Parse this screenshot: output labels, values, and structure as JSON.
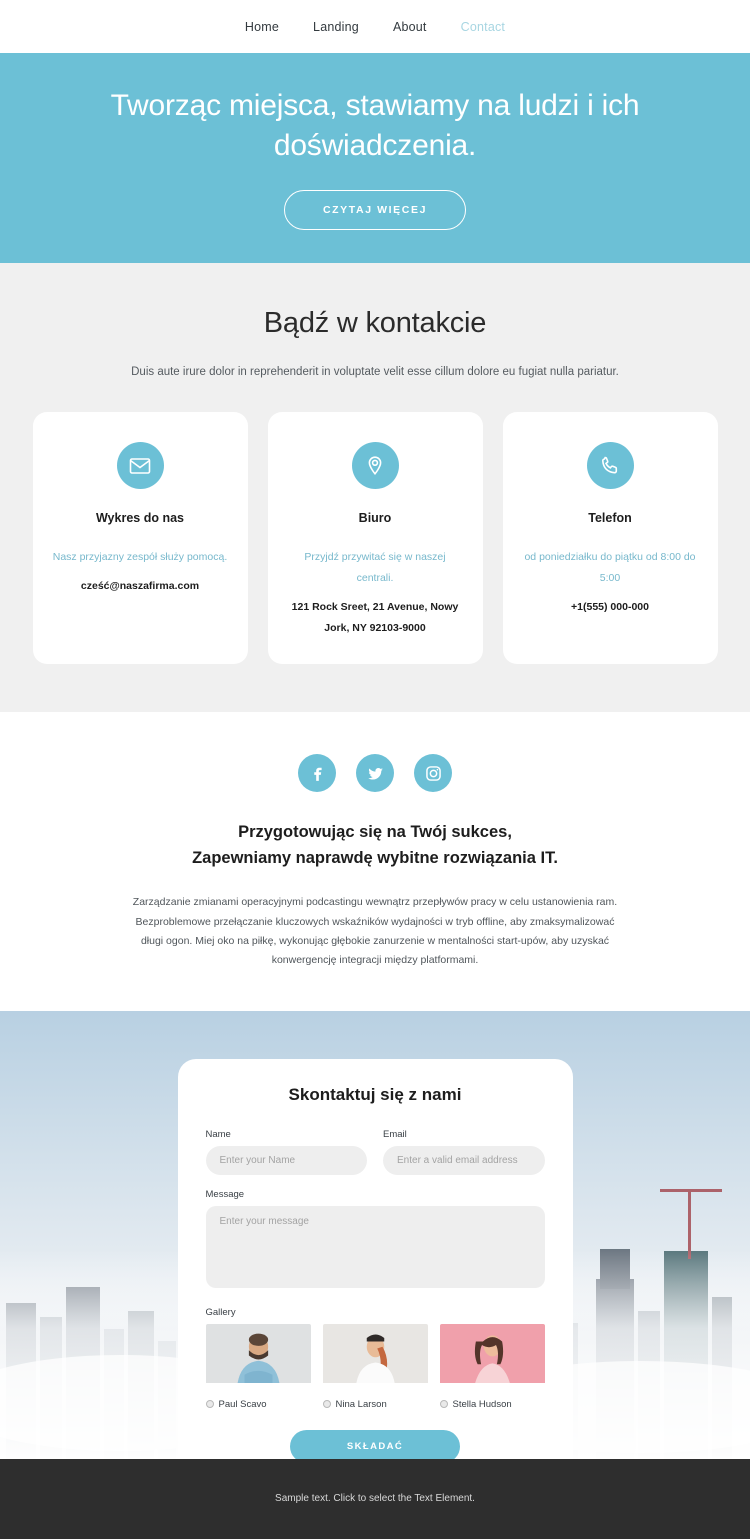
{
  "nav": {
    "items": [
      {
        "label": "Home",
        "active": false
      },
      {
        "label": "Landing",
        "active": false
      },
      {
        "label": "About",
        "active": false
      },
      {
        "label": "Contact",
        "active": true
      }
    ]
  },
  "hero": {
    "title": "Tworząc miejsca, stawiamy na ludzi i ich doświadczenia.",
    "cta_label": "CZYTAJ WIĘCEJ"
  },
  "contact": {
    "title": "Bądź w kontakcie",
    "subtitle": "Duis aute irure dolor in reprehenderit in voluptate velit esse cillum dolore eu fugiat nulla pariatur.",
    "cards": [
      {
        "icon": "envelope-icon",
        "title": "Wykres do nas",
        "note": "Nasz przyjazny zespół służy pomocą.",
        "value": "cześć@naszafirma.com"
      },
      {
        "icon": "map-pin-icon",
        "title": "Biuro",
        "note": "Przyjdź przywitać się w naszej centrali.",
        "value": "121 Rock Sreet, 21 Avenue, Nowy Jork, NY 92103-9000"
      },
      {
        "icon": "phone-icon",
        "title": "Telefon",
        "note": "od poniedziałku do piątku od 8:00 do 5:00",
        "value": "+1(555) 000-000"
      }
    ]
  },
  "about": {
    "socials": [
      {
        "name": "facebook-icon"
      },
      {
        "name": "twitter-icon"
      },
      {
        "name": "instagram-icon"
      }
    ],
    "title_line1": "Przygotowując się na Twój sukces,",
    "title_line2": "Zapewniamy naprawdę wybitne rozwiązania IT.",
    "body": "Zarządzanie zmianami operacyjnymi podcastingu wewnątrz przepływów pracy w celu ustanowienia ram. Bezproblemowe przełączanie kluczowych wskaźników wydajności w tryb offline, aby zmaksymalizować długi ogon. Miej oko na piłkę, wykonując głębokie zanurzenie w mentalności start-upów, aby uzyskać konwergencję integracji między platformami."
  },
  "form": {
    "title": "Skontaktuj się z nami",
    "name_label": "Name",
    "name_placeholder": "Enter your Name",
    "name_value": "",
    "email_label": "Email",
    "email_placeholder": "Enter a valid email address",
    "email_value": "",
    "message_label": "Message",
    "message_placeholder": "Enter your message",
    "message_value": "",
    "gallery_label": "Gallery",
    "gallery": [
      {
        "name": "Paul Scavo",
        "selected": false
      },
      {
        "name": "Nina Larson",
        "selected": false
      },
      {
        "name": "Stella Hudson",
        "selected": false
      }
    ],
    "submit_label": "SKŁADAĆ"
  },
  "footer": {
    "text": "Sample text. Click to select the Text Element."
  },
  "colors": {
    "accent": "#6cc0d6",
    "section_gray": "#f0f0f0",
    "footer_dark": "#2e2e2e",
    "note_text": "#77b8cc"
  }
}
